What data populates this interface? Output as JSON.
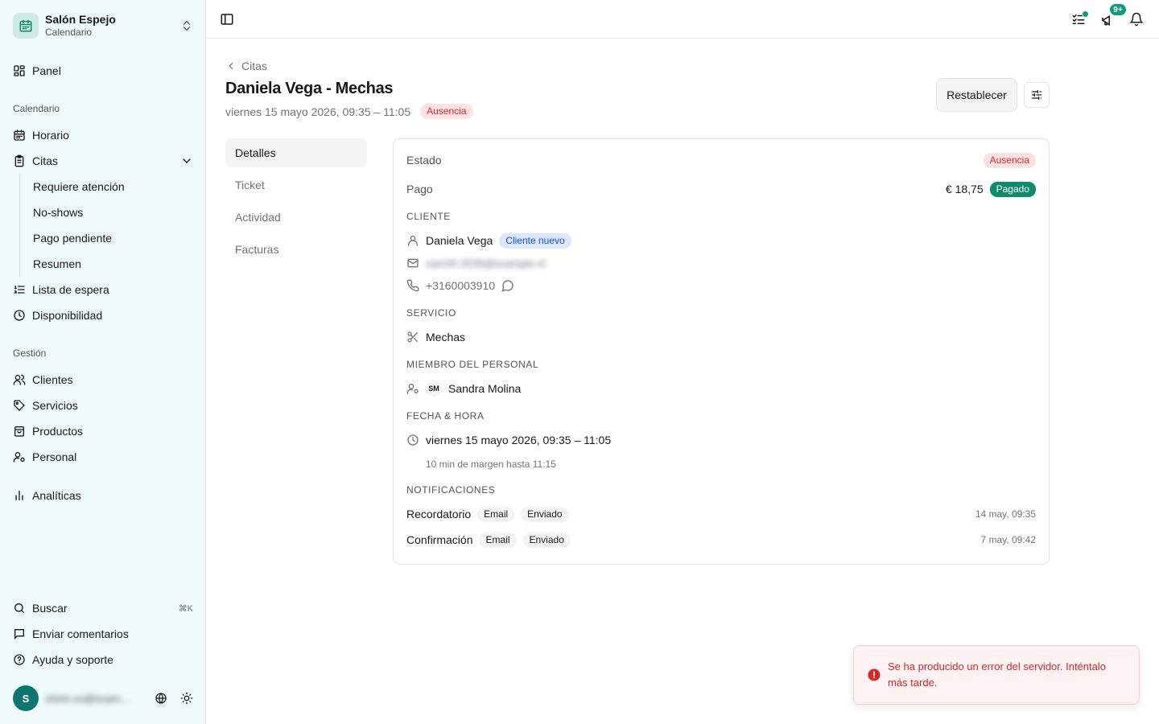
{
  "sidebar": {
    "brand": {
      "name": "Salón Espejo",
      "subtitle": "Calendario"
    },
    "panel_label": "Panel",
    "groups": {
      "calendar": "Calendario",
      "management": "Gestión"
    },
    "items": {
      "horario": "Horario",
      "citas": "Citas",
      "lista_espera": "Lista de espera",
      "disponibilidad": "Disponibilidad",
      "clientes": "Clientes",
      "servicios": "Servicios",
      "productos": "Productos",
      "personal": "Personal",
      "analiticas": "Analíticas"
    },
    "citas_sub": [
      "Requiere atención",
      "No-shows",
      "Pago pendiente",
      "Resumen"
    ],
    "footer": {
      "search": "Buscar",
      "search_shortcut": "⌘K",
      "feedback": "Enviar comentarios",
      "help": "Ayuda y soporte"
    },
    "user": {
      "initial": "S",
      "email_obscured": "shirin.vo@exam..."
    }
  },
  "topbar": {
    "notifications_count": "9+"
  },
  "page": {
    "back_label": "Citas",
    "title": "Daniela Vega - Mechas",
    "datetime": "viernes 15 mayo 2026, 09:35 – 11:05",
    "status_badge": "Ausencia",
    "reset_button": "Restablecer"
  },
  "tabs": [
    "Detalles",
    "Ticket",
    "Actividad",
    "Facturas"
  ],
  "details": {
    "estado_label": "Estado",
    "estado_value": "Ausencia",
    "pago_label": "Pago",
    "pago_amount": "€ 18,75",
    "pago_status": "Pagado",
    "cliente_heading": "CLIENTE",
    "cliente_name": "Daniela Vega",
    "cliente_badge": "Cliente nuevo",
    "cliente_email_obscured": "xam35-3539@example.nl",
    "cliente_phone": "+3160003910",
    "servicio_heading": "SERVICIO",
    "servicio_name": "Mechas",
    "staff_heading": "MIEMBRO DEL PERSONAL",
    "staff_initials": "SM",
    "staff_name": "Sandra Molina",
    "fecha_heading": "FECHA & HORA",
    "fecha_value": "viernes 15 mayo 2026, 09:35 – 11:05",
    "fecha_margin": "10 min de margen hasta 11:15",
    "notif_heading": "NOTIFICACIONES",
    "notifications": [
      {
        "type": "Recordatorio",
        "channel": "Email",
        "status": "Enviado",
        "time": "14 may, 09:35"
      },
      {
        "type": "Confirmación",
        "channel": "Email",
        "status": "Enviado",
        "time": "7 may, 09:42"
      }
    ]
  },
  "toast": {
    "message": "Se ha producido un error del servidor. Inténtalo más tarde."
  },
  "colors": {
    "accent": "#0f8a6c",
    "sidebar_bg": "#effafa",
    "danger": "#dc2626",
    "info": "#1d4ed8"
  }
}
